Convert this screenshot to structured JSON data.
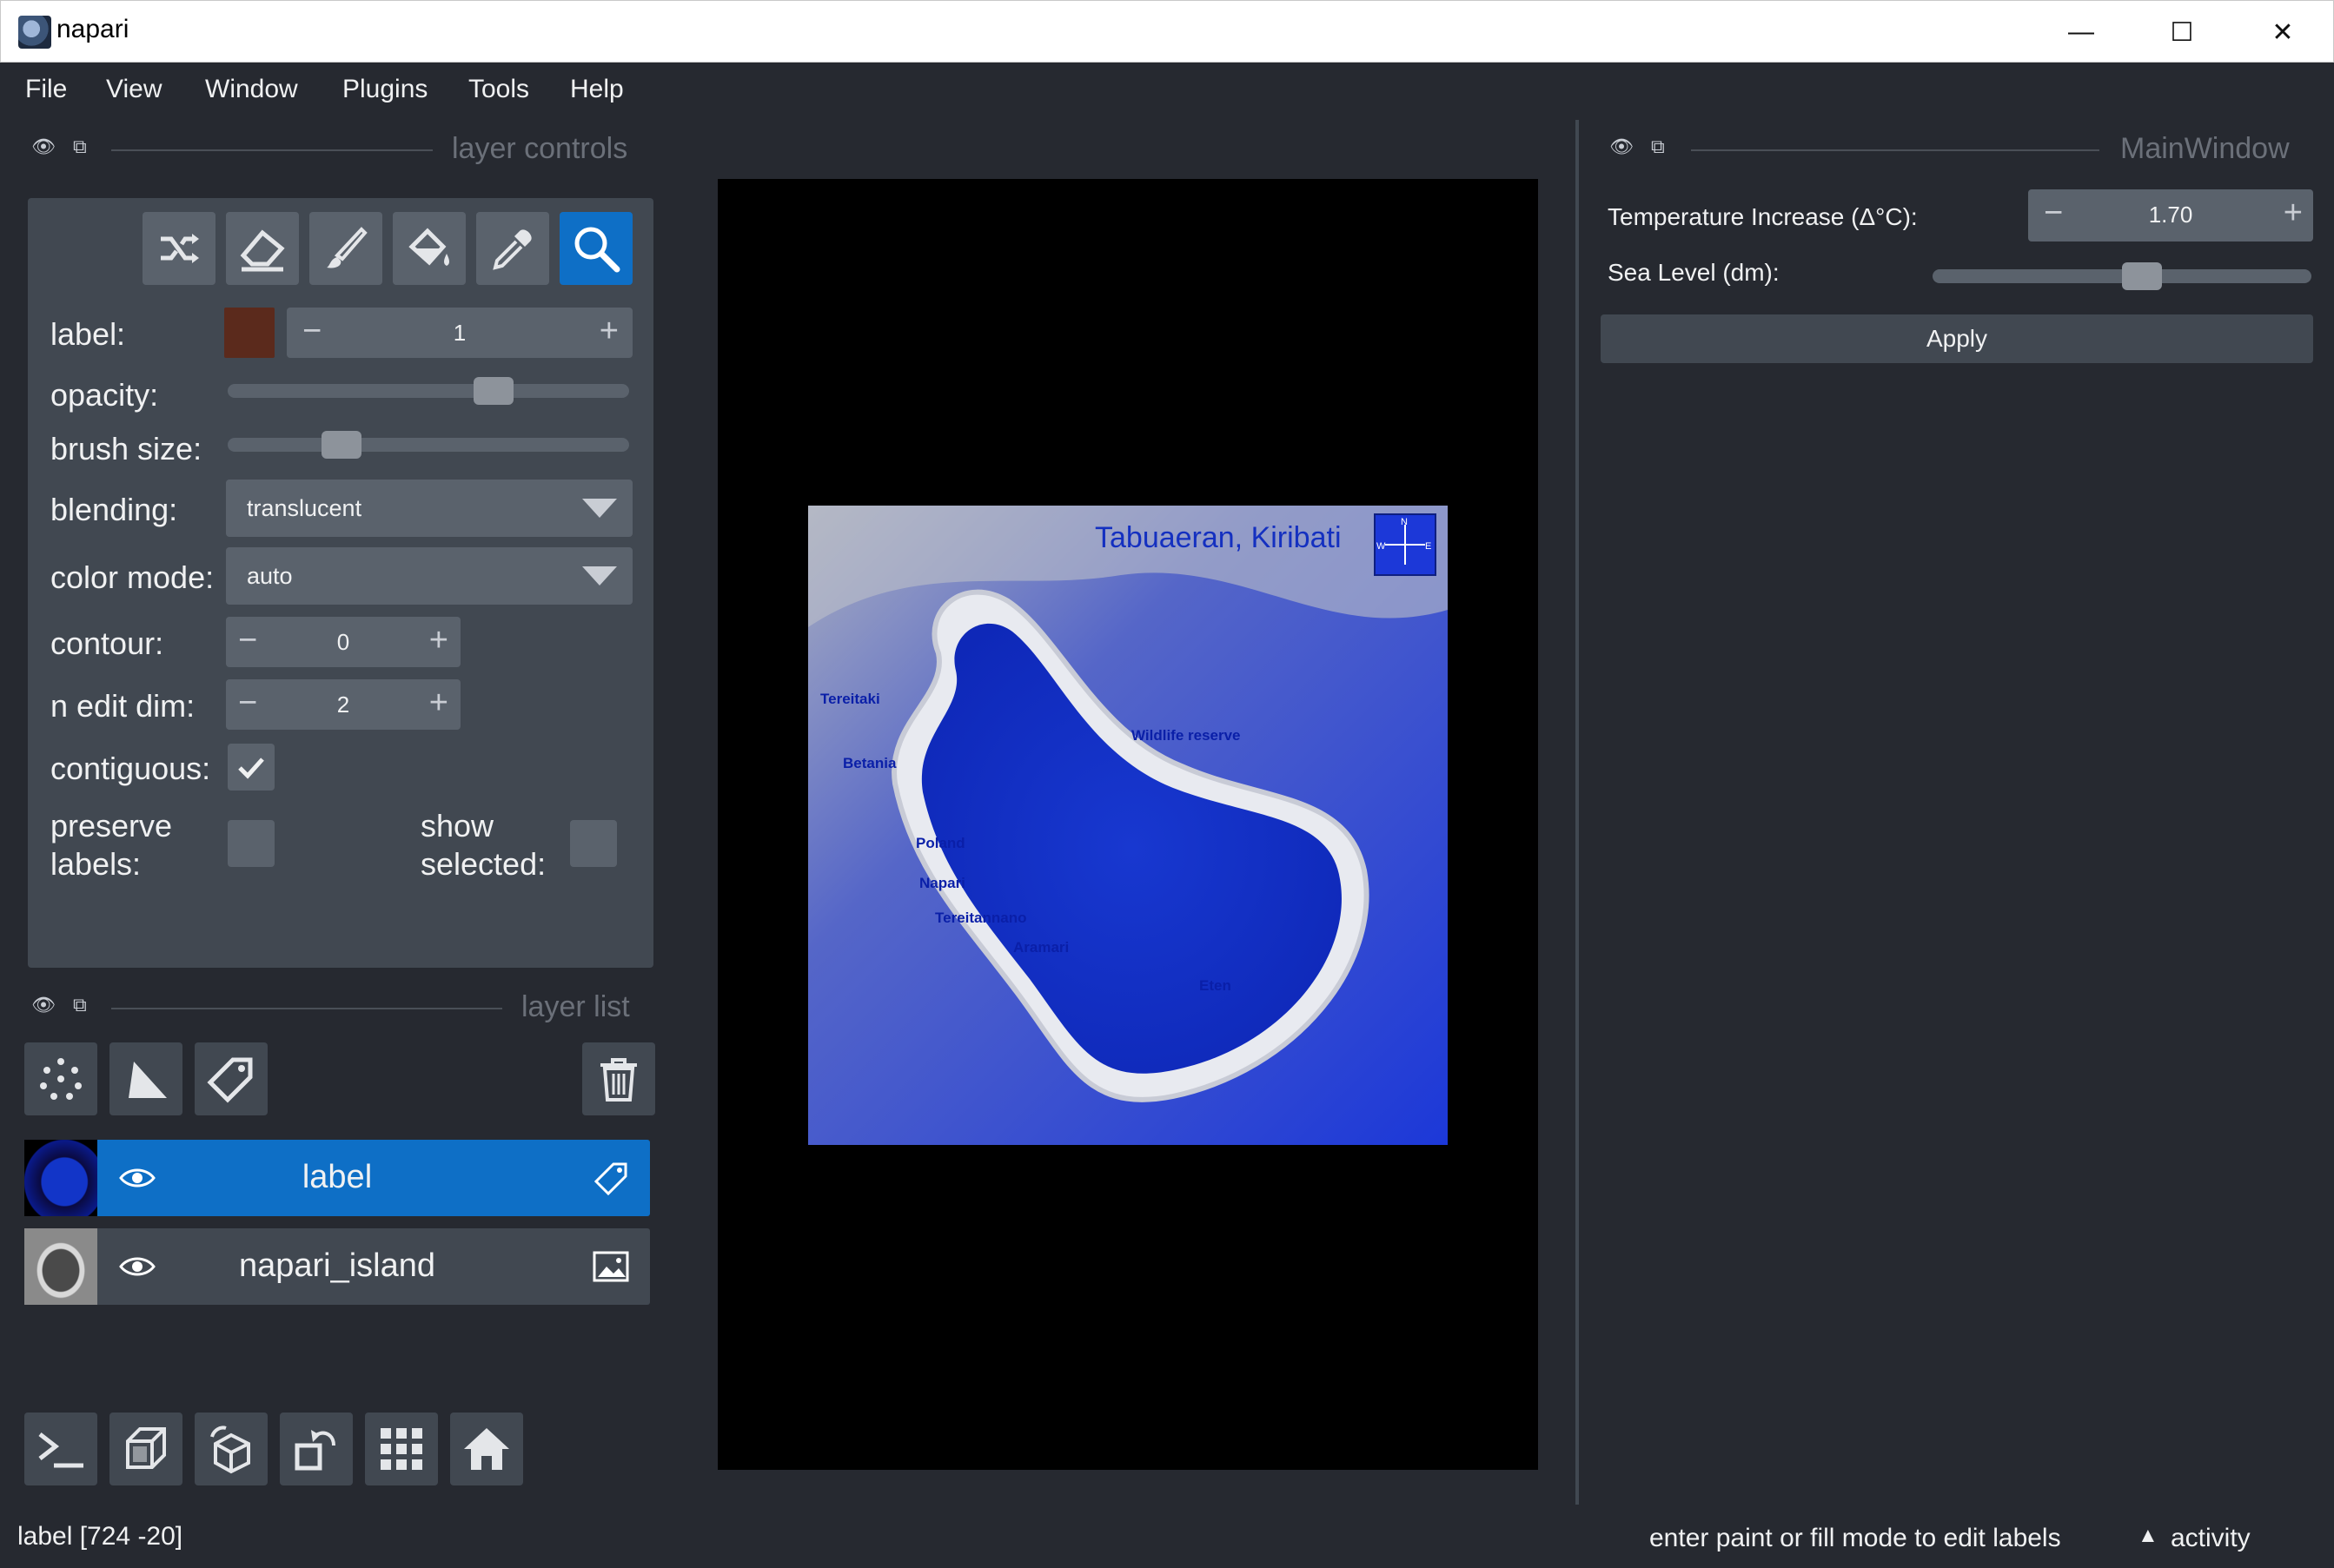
{
  "window": {
    "title": "napari",
    "minimize": "—",
    "maximize": "☐",
    "close": "✕"
  },
  "menu": [
    "File",
    "View",
    "Window",
    "Plugins",
    "Tools",
    "Help"
  ],
  "layer_controls": {
    "title": "layer controls",
    "tools": [
      "shuffle-icon",
      "eraser-icon",
      "brush-icon",
      "fill-bucket-icon",
      "picker-icon",
      "zoom-icon"
    ],
    "active_tool": "zoom-icon",
    "label": {
      "text": "label:",
      "value": "1",
      "swatch_color": "#5b2a1c"
    },
    "opacity": {
      "text": "opacity:",
      "level": 0.68
    },
    "brush_size": {
      "text": "brush size:",
      "level": 0.26
    },
    "blending": {
      "text": "blending:",
      "value": "translucent"
    },
    "color_mode": {
      "text": "color mode:",
      "value": "auto"
    },
    "contour": {
      "text": "contour:",
      "value": "0"
    },
    "n_edit_dim": {
      "text": "n edit dim:",
      "value": "2"
    },
    "contiguous": {
      "text": "contiguous:",
      "checked": true
    },
    "preserve_labels": {
      "text_1": "preserve",
      "text_2": "labels:",
      "checked": false
    },
    "show_selected": {
      "text_1": "show",
      "text_2": "selected:",
      "checked": false
    }
  },
  "layer_list": {
    "title": "layer list",
    "buttons": [
      "new-points-icon",
      "new-shapes-icon",
      "new-labels-icon",
      "delete-layer-icon"
    ],
    "layers": [
      {
        "name": "label",
        "type_icon": "label-tag-icon",
        "selected": true,
        "visible": true
      },
      {
        "name": "napari_island",
        "type_icon": "image-icon",
        "selected": false,
        "visible": true
      }
    ]
  },
  "bottom_buttons": [
    "console-icon",
    "ndisplay-icon",
    "roll-dims-icon",
    "transpose-icon",
    "grid-icon",
    "home-icon"
  ],
  "canvas": {
    "image_title": "Tabuaeran, Kiribati",
    "place_labels": [
      "Tereitaki",
      "Betania",
      "Wildlife reserve",
      "Poland",
      "Napari",
      "Tereitannano",
      "Aramari",
      "Eten"
    ],
    "compass": {
      "n": "N",
      "e": "E",
      "w": "W"
    }
  },
  "main_window": {
    "title": "MainWindow",
    "temperature": {
      "label": "Temperature Increase (Δ°C):",
      "value": "1.70"
    },
    "sea_level": {
      "label": "Sea Level (dm):",
      "level": 0.56
    },
    "apply_label": "Apply"
  },
  "status": {
    "left": "label [724 -20]",
    "hint": "enter paint or fill mode to edit labels",
    "activity": "activity",
    "activity_arrow": "▲"
  },
  "colors": {
    "background": "#262930",
    "panel": "#414851",
    "control": "#5a626c",
    "accent": "#0e6fc6"
  }
}
